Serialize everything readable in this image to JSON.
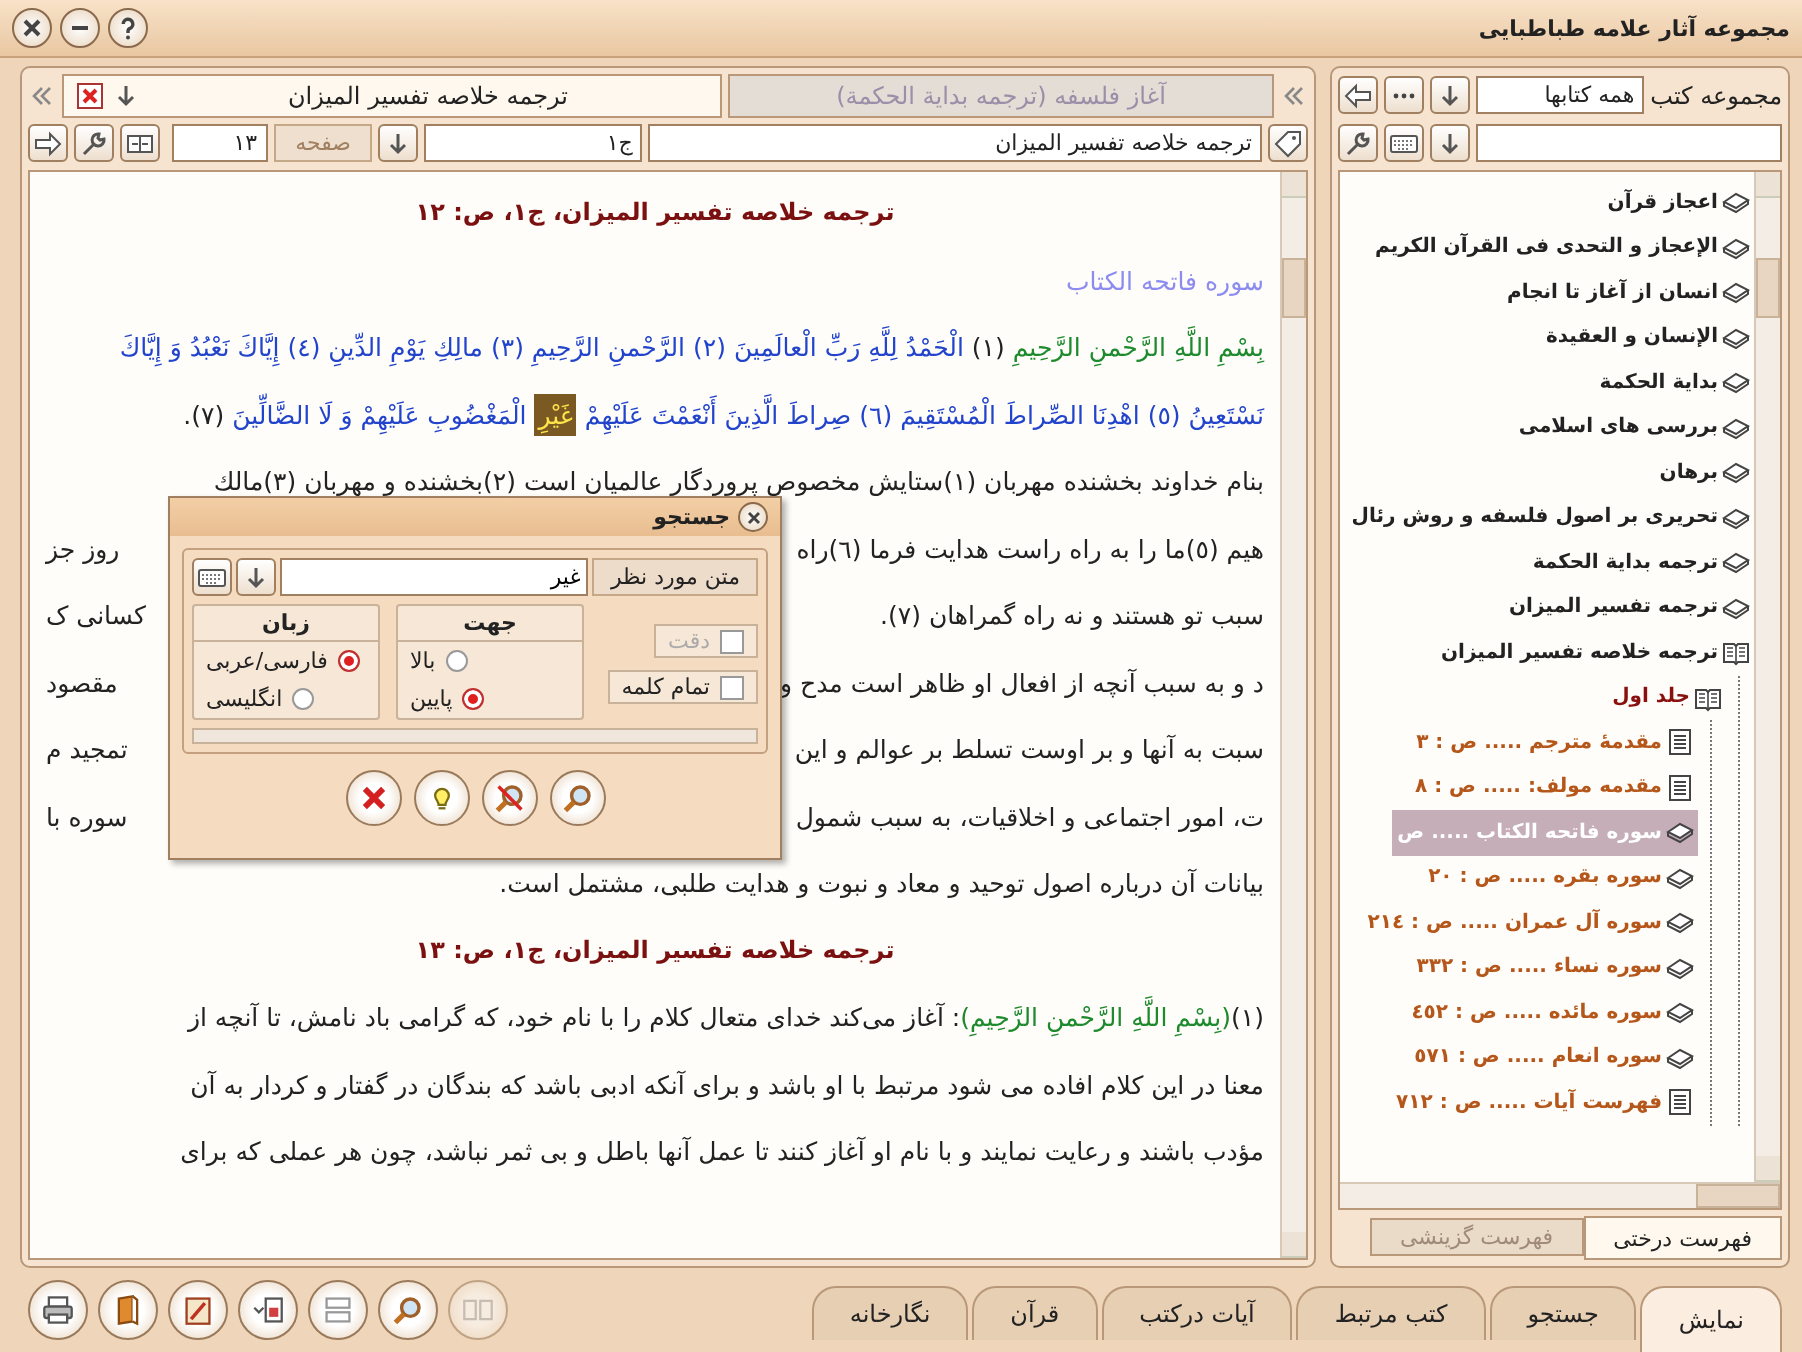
{
  "window": {
    "title": "مجموعه آثار علامه طباطبایی"
  },
  "reader": {
    "tabs": [
      {
        "label": "آغاز فلسفه (ترجمه بداية الحكمة)",
        "selected": false
      },
      {
        "label": "ترجمه خلاصه تفسیر المیزان",
        "selected": true
      }
    ],
    "nav": {
      "book": "ترجمه خلاصه تفسیر المیزان",
      "volume": "ج١",
      "page_label": "صفحه",
      "page": "١٣"
    },
    "content": [
      {
        "kind": "heading",
        "text": "ترجمه خلاصه تفسیر المیزان، ج١، ص: ١٢"
      },
      {
        "kind": "surah",
        "text": "سوره فاتحه الكتاب"
      },
      {
        "kind": "verse",
        "parts": [
          {
            "kind": "basmala",
            "text": "بِسْمِ اللَّهِ الرَّحْمنِ الرَّحِيمِ "
          },
          {
            "kind": "plain",
            "text": "(١) "
          },
          {
            "kind": "verse",
            "text": "الْحَمْدُ لِلَّهِ رَبِّ الْعالَمِينَ (٢) الرَّحْمنِ الرَّحِيمِ (٣) مالِكِ يَوْمِ الدِّينِ (٤) إِيَّاكَ نَعْبُدُ وَ إِيَّاكَ"
          }
        ]
      },
      {
        "kind": "verse",
        "parts": [
          {
            "kind": "verse",
            "text": "نَسْتَعِينُ (٥) اهْدِنَا الصِّراطَ الْمُسْتَقِيمَ (٦) صِراطَ الَّذِينَ أَنْعَمْتَ عَلَيْهِمْ "
          },
          {
            "kind": "match",
            "text": "غَيْرِ"
          },
          {
            "kind": "verse",
            "text": " الْمَغْضُوبِ عَلَيْهِمْ وَ لَا الضَّالِّينَ "
          },
          {
            "kind": "plain",
            "text": "(٧)."
          }
        ]
      },
      {
        "kind": "line",
        "text": "بنام خداوند بخشنده مهربان (١)ستايش مخصوص پروردگار عالميان است (٢)بخشنده و مهربان (٣)مالك"
      },
      {
        "kind": "split",
        "left": "روز جز",
        "right": "هیم (٥)ما را به راه راست هدایت فرما (٦)راه"
      },
      {
        "kind": "split",
        "left": "کسانی ک",
        "right": "سبب تو هستند و نه راه گمراهان (٧)."
      },
      {
        "kind": "split",
        "left": "مقصود",
        "right": "د و به سبب آنچه از افعال او ظاهر است مدح و"
      },
      {
        "kind": "split",
        "left": "تمجید م",
        "right": "سبت به آنها و بر اوست تسلط بر عوالم و این"
      },
      {
        "kind": "split",
        "left": "سوره با",
        "right": "ت، امور اجتماعی و اخلاقیات، به سبب شمول"
      },
      {
        "kind": "line",
        "text": "بیانات آن درباره اصول توحید و معاد و نبوت و هدایت طلبی، مشتمل است."
      },
      {
        "kind": "heading",
        "text": "ترجمه خلاصه تفسیر المیزان، ج١، ص: ١٣"
      },
      {
        "kind": "verse",
        "parts": [
          {
            "kind": "plain",
            "text": "(١)"
          },
          {
            "kind": "basmala",
            "text": "(بِسْمِ اللَّهِ الرَّحْمنِ الرَّحِيمِ)"
          },
          {
            "kind": "plain",
            "text": ": آغاز می‌کند خدای متعال کلام را با نام خود، که گرامی باد نامش، تا آنچه از"
          }
        ]
      },
      {
        "kind": "line",
        "text": "معنا در این کلام افاده می شود مرتبط با او باشد و برای آنکه ادبی باشد که بندگان در گفتار و کردار به آن"
      },
      {
        "kind": "line",
        "text": "مؤدب باشند و رعایت نمایند و با نام او آغاز کنند تا عمل آنها باطل و بی ثمر نباشد، چون هر عملی که برای"
      }
    ]
  },
  "library": {
    "label": "مجموعه کتب",
    "filter": "همه کتابها",
    "tree": [
      {
        "label": "اعجاز قرآن",
        "kind": "book",
        "expanded": false,
        "selected": false
      },
      {
        "label": "الإعجاز و التحدی فی القرآن الکریم",
        "kind": "book",
        "expanded": false,
        "selected": false
      },
      {
        "label": "انسان از آغاز تا انجام",
        "kind": "book",
        "expanded": false,
        "selected": false
      },
      {
        "label": "الإنسان و العقيدة",
        "kind": "book",
        "expanded": false,
        "selected": false
      },
      {
        "label": "بداية الحكمة",
        "kind": "book",
        "expanded": false,
        "selected": false
      },
      {
        "label": "بررسی های اسلامی",
        "kind": "book",
        "expanded": false,
        "selected": false
      },
      {
        "label": "برهان",
        "kind": "book",
        "expanded": false,
        "selected": false
      },
      {
        "label": "تحریری بر اصول فلسفه و روش رئال",
        "kind": "book",
        "expanded": false,
        "selected": false
      },
      {
        "label": "ترجمه بداية الحكمة",
        "kind": "book",
        "expanded": false,
        "selected": false
      },
      {
        "label": "ترجمه تفسیر المیزان",
        "kind": "book",
        "expanded": false,
        "selected": false
      },
      {
        "label": "ترجمه خلاصه تفسیر المیزان",
        "kind": "book",
        "expanded": true,
        "selected": false,
        "children": [
          {
            "label": "جلد اول",
            "kind": "book",
            "expanded": true,
            "selected": false,
            "children": [
              {
                "label": "مقدمهٔ مترجم ..... ص : ٣",
                "kind": "page",
                "selected": false
              },
              {
                "label": "مقدمه مولف: ..... ص : ٨",
                "kind": "page",
                "selected": false
              },
              {
                "label": "سوره فاتحه الكتاب ..... ص",
                "kind": "book",
                "expanded": false,
                "selected": true
              },
              {
                "label": "سوره بقره ..... ص : ٢٠",
                "kind": "book",
                "expanded": false,
                "selected": false
              },
              {
                "label": "سوره آل عمران ..... ص : ٢١٤",
                "kind": "book",
                "expanded": false,
                "selected": false
              },
              {
                "label": "سوره نساء ..... ص : ٣٣٢",
                "kind": "book",
                "expanded": false,
                "selected": false
              },
              {
                "label": "سوره مائده ..... ص : ٤٥٢",
                "kind": "book",
                "expanded": false,
                "selected": false
              },
              {
                "label": "سوره انعام ..... ص : ٥٧١",
                "kind": "book",
                "expanded": false,
                "selected": false
              },
              {
                "label": "فهرست آیات ..... ص : ٧١٢",
                "kind": "page",
                "selected": false
              }
            ]
          }
        ]
      }
    ],
    "tabs": [
      {
        "label": "فهرست درختی",
        "selected": true
      },
      {
        "label": "فهرست گزینشی",
        "selected": false
      }
    ]
  },
  "bottom_tabs": [
    {
      "label": "نمایش",
      "selected": true
    },
    {
      "label": "جستجو",
      "selected": false
    },
    {
      "label": "کتب مرتبط",
      "selected": false
    },
    {
      "label": "آیات درکتب",
      "selected": false
    },
    {
      "label": "قرآن",
      "selected": false
    },
    {
      "label": "نگارخانه",
      "selected": false
    }
  ],
  "search_dialog": {
    "title": "جستجو",
    "field_label": "متن مورد نظر",
    "query": "غیر",
    "options": [
      {
        "label": "دقت",
        "checked": false,
        "disabled": true
      },
      {
        "label": "تمام کلمه",
        "checked": false,
        "disabled": false
      }
    ],
    "groups": [
      {
        "title": "جهت",
        "options": [
          {
            "label": "بالا",
            "selected": false
          },
          {
            "label": "پایین",
            "selected": true
          }
        ]
      },
      {
        "title": "زبان",
        "options": [
          {
            "label": "فارسی/عربی",
            "selected": true
          },
          {
            "label": "انگلیسی",
            "selected": false
          }
        ]
      }
    ],
    "progress": {
      "level": 0
    }
  }
}
